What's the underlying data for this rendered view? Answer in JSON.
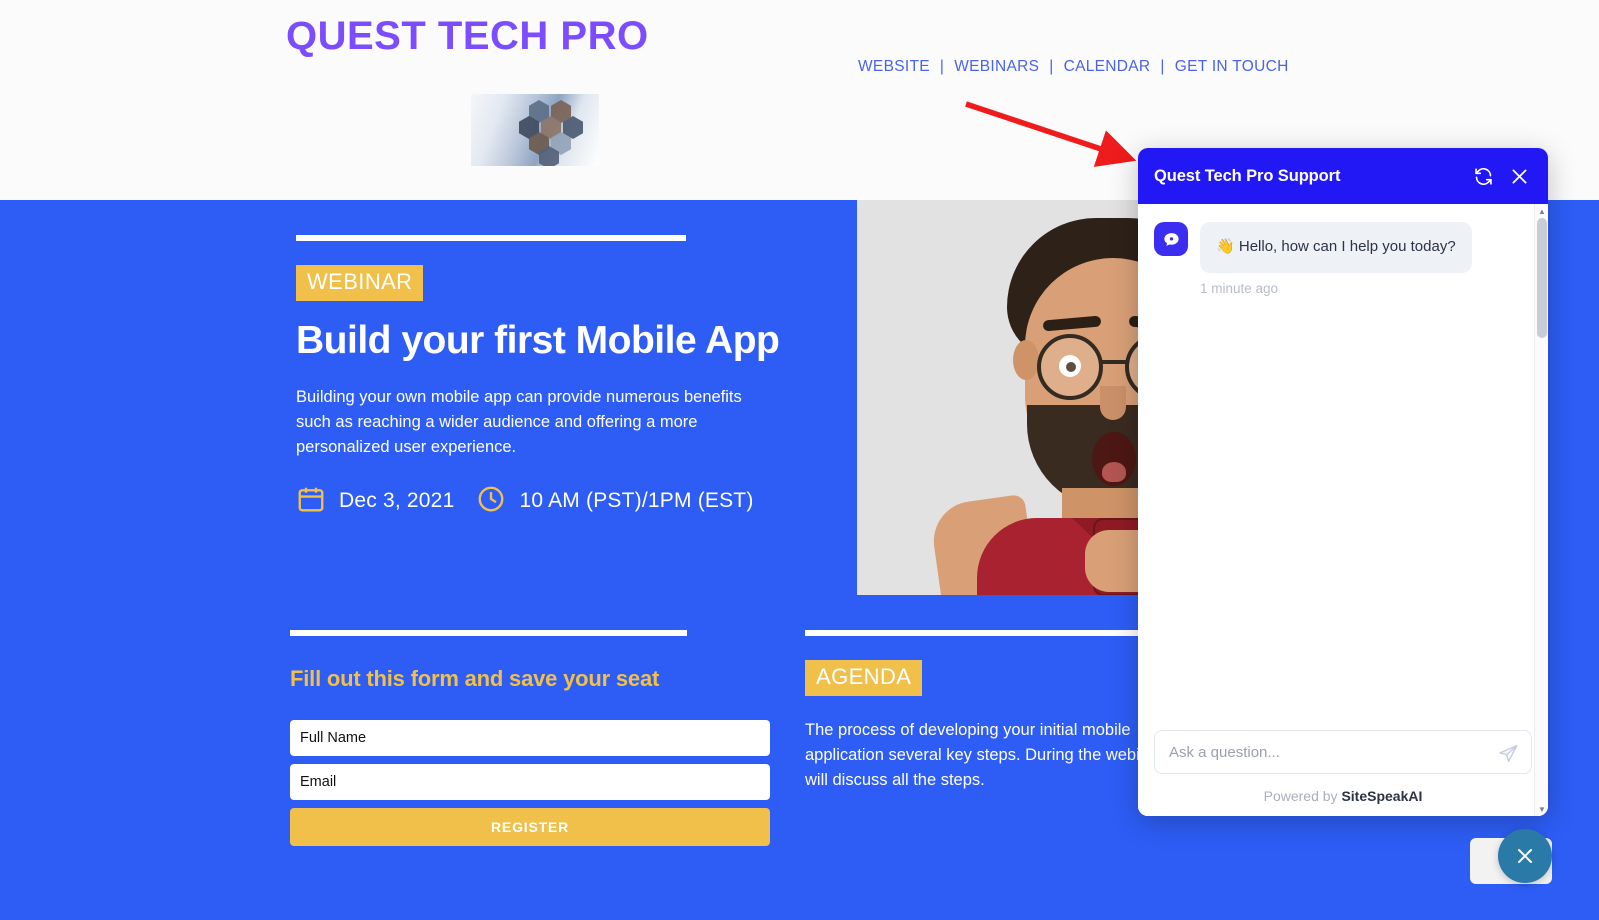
{
  "header": {
    "brand": "QUEST TECH PRO",
    "brand_color": "#7c4dff",
    "brand_image_name": "team-hexagon-collage-image",
    "nav": [
      {
        "label": "WEBSITE"
      },
      {
        "label": "WEBINARS"
      },
      {
        "label": "CALENDAR"
      },
      {
        "label": "GET IN TOUCH"
      }
    ],
    "nav_separator": "|"
  },
  "hero": {
    "badge": "WEBINAR",
    "title": "Build your first Mobile App",
    "description": "Building your own mobile app can provide numerous benefits such as reaching a wider audience and offering a more personalized user experience.",
    "date": "Dec 3, 2021",
    "time": "10 AM (PST)/1PM (EST)",
    "date_icon": "calendar-icon",
    "time_icon": "clock-icon",
    "photo_alt": "surprised-man-with-phone-photo",
    "background_color": "#2d5df5",
    "accent_color": "#f0c04b"
  },
  "form": {
    "heading": "Fill out this form and save your seat",
    "full_name_placeholder": "Full Name",
    "full_name_value": "",
    "email_placeholder": "Email",
    "email_value": "",
    "submit_label": "REGISTER"
  },
  "agenda": {
    "badge": "AGENDA",
    "text": "The process of developing your initial mobile application several key steps. During the webinar we will discuss all the steps."
  },
  "chat": {
    "title": "Quest Tech Pro Support",
    "header_color": "#2118f5",
    "refresh_icon": "refresh-icon",
    "close_icon": "close-icon",
    "bot_avatar_icon": "chat-bubble-icon",
    "messages": [
      {
        "emoji": "👋",
        "text": "Hello, how can I help you today?",
        "timestamp": "1 minute ago",
        "sender": "bot"
      }
    ],
    "input_placeholder": "Ask a question...",
    "input_value": "",
    "send_icon": "send-icon",
    "powered_by_prefix": "Powered by ",
    "powered_by_brand": "SiteSpeakAI",
    "scroll_up_icon": "▲",
    "scroll_down_icon": "▼"
  },
  "launcher": {
    "close_icon": "close-icon",
    "color": "#2a7aa8"
  },
  "annotation": {
    "pointer_arrow": "red-pointer-arrow",
    "pointer_color": "#ee1c1c"
  }
}
